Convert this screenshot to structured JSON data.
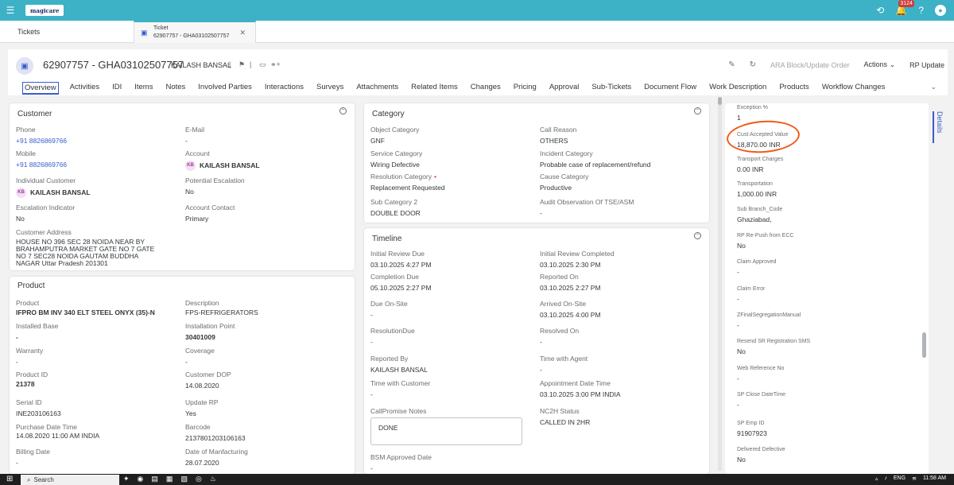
{
  "shell": {
    "brand": "magicare",
    "notification_count": "3124"
  },
  "tabs": {
    "tickets": "Tickets",
    "ticket_tab_line1": "Ticket",
    "ticket_tab_line2": "62907757 - GHA03102507757"
  },
  "header": {
    "title": "62907757 - GHA03102507757",
    "owner": "KAILASH BANSAL",
    "sep": "|",
    "actions": {
      "ara": "ARA Block/Update Order",
      "actions": "Actions",
      "rp_update": "RP Update"
    }
  },
  "nav": {
    "tabs": [
      "Overview",
      "Activities",
      "IDI",
      "Items",
      "Notes",
      "Involved Parties",
      "Interactions",
      "Surveys",
      "Attachments",
      "Related Items",
      "Changes",
      "Pricing",
      "Approval",
      "Sub-Tickets",
      "Document Flow",
      "Work Description",
      "Products",
      "Workflow Changes"
    ]
  },
  "customer": {
    "title": "Customer",
    "phone_label": "Phone",
    "phone": "+91 8826869766",
    "email_label": "E-Mail",
    "email": "-",
    "mobile_label": "Mobile",
    "mobile": "+91 8826869766",
    "account_label": "Account",
    "account_initials": "KB",
    "account": "KAILASH BANSAL",
    "individual_label": "Individual Customer",
    "individual_initials": "KB",
    "individual": "KAILASH BANSAL",
    "potential_label": "Potential Escalation",
    "potential": "No",
    "escalation_label": "Escalation Indicator",
    "escalation": "No",
    "contact_label": "Account Contact",
    "contact": "Primary",
    "address_label": "Customer Address",
    "address": "HOUSE NO 396 SEC 28 NOIDA NEAR BY BRAHAMPUTRA MARKET GATE NO 7 GATE NO 7 SEC28 NOIDA GAUTAM BUDDHA NAGAR Uttar Pradesh 201301"
  },
  "product": {
    "title": "Product",
    "product_label": "Product",
    "product": "IFPRO BM INV 340 ELT STEEL ONYX (35)-N",
    "description_label": "Description",
    "description": "FPS-REFRIGERATORS",
    "installed_base_label": "Installed Base",
    "installed_base": "-",
    "installation_point_label": "Installation Point",
    "installation_point": "30401009",
    "warranty_label": "Warranty",
    "warranty": "-",
    "coverage_label": "Coverage",
    "coverage": "-",
    "product_id_label": "Product ID",
    "product_id": "21378",
    "dop_label": "Customer DOP",
    "dop": "14.08.2020",
    "serial_label": "Serial ID",
    "serial": "INE203106163",
    "update_rp_label": "Update RP",
    "update_rp": "Yes",
    "purchase_label": "Purchase Date Time",
    "purchase": "14.08.2020 11:00 AM INDIA",
    "barcode_label": "Barcode",
    "barcode": "2137801203106163",
    "billing_label": "Billing Date",
    "billing": "-",
    "manufacturing_label": "Date of Manfacturing",
    "manufacturing": "28.07.2020"
  },
  "category": {
    "title": "Category",
    "object_label": "Object Category",
    "object": "GNF",
    "call_reason_label": "Call Reason",
    "call_reason": "OTHERS",
    "service_label": "Service Category",
    "service": "Wiring Defective",
    "incident_label": "Incident Category",
    "incident": "Probable case of replacement/refund",
    "resolution_label": "Resolution Category",
    "resolution": "Replacement Requested",
    "cause_label": "Cause Category",
    "cause": "Productive",
    "sub_label": "Sub Category 2",
    "sub": "DOUBLE DOOR",
    "audit_label": "Audit Observation Of TSE/ASM",
    "audit": "-"
  },
  "timeline": {
    "title": "Timeline",
    "ird_label": "Initial Review Due",
    "ird": "03.10.2025 4:27 PM",
    "irc_label": "Initial Review Completed",
    "irc": "03.10.2025 2:30 PM",
    "cd_label": "Completion Due",
    "cd": "05.10.2025 2:27 PM",
    "ro_label": "Reported On",
    "ro": "03.10.2025 2:27 PM",
    "dos_label": "Due On-Site",
    "dos": "-",
    "aos_label": "Arrived On-Site",
    "aos": "03.10.2025 4:00 PM",
    "resdue_label": "ResolutionDue",
    "resdue": "-",
    "reson_label": "Resolved On",
    "reson": "-",
    "repby_label": "Reported By",
    "repby": "KAILASH BANSAL",
    "twa_label": "Time with Agent",
    "twa": "-",
    "twc_label": "Time with Customer",
    "twc": "-",
    "adt_label": "Appointment Date Time",
    "adt": "03.10.2025 3:00 PM INDIA",
    "cpn_label": "CallPromise Notes",
    "cpn": "DONE",
    "nc2h_label": "NC2H Status",
    "nc2h": "CALLED IN 2HR",
    "bsm_label": "BSM Approved Date",
    "bsm": "-"
  },
  "side": {
    "details_tab": "Details",
    "fields": [
      {
        "label": "Exception %",
        "value": "1"
      },
      {
        "label": "Cust Accepted Value",
        "value": "18,870.00  INR"
      },
      {
        "label": "Transport Charges",
        "value": "0.00  INR"
      },
      {
        "label": "Transportation",
        "value": "1,000.00  INR"
      },
      {
        "label": "Sub Branch_Code",
        "value": "Ghaziabad,"
      },
      {
        "label": "RP Re-Push from ECC",
        "value": "No"
      },
      {
        "label": "Claim Approved",
        "value": "-"
      },
      {
        "label": "Claim Error",
        "value": "-"
      },
      {
        "label": "ZFinalSegregationManual",
        "value": "-"
      },
      {
        "label": "Resend SR Registration SMS",
        "value": "No"
      },
      {
        "label": "Web Reference No",
        "value": "-"
      },
      {
        "label": "SP Close DateTime",
        "value": "-"
      },
      {
        "label": "SP Emp ID",
        "value": "91907923"
      },
      {
        "label": "Delivered Defective",
        "value": "No"
      }
    ]
  },
  "taskbar": {
    "search": "Search",
    "lang": "ENG",
    "time": "11:58 AM"
  },
  "colors": {
    "shell": "#3db1c6",
    "accent": "#3a5ccc",
    "annotation": "#f05a1a"
  }
}
